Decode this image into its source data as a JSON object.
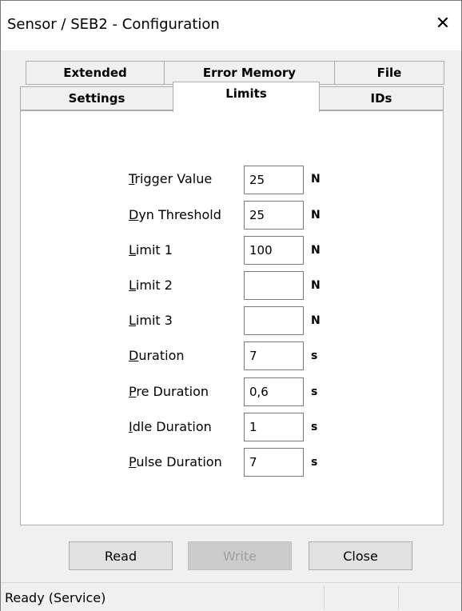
{
  "window": {
    "title": "Sensor / SEB2 - Configuration",
    "close_glyph": "✕"
  },
  "tabs": {
    "row_back": [
      {
        "label": "Extended"
      },
      {
        "label": "Error Memory"
      },
      {
        "label": "File"
      }
    ],
    "row_front": [
      {
        "label": "Settings"
      },
      {
        "label": "Limits",
        "active": true
      },
      {
        "label": "IDs"
      }
    ]
  },
  "fields": [
    {
      "mnemonic": "T",
      "rest": "rigger Value",
      "value": "25",
      "unit": "N"
    },
    {
      "mnemonic": "D",
      "rest": "yn Threshold",
      "value": "25",
      "unit": "N"
    },
    {
      "mnemonic": "L",
      "rest": "imit 1",
      "value": "100",
      "unit": "N"
    },
    {
      "mnemonic": "L",
      "rest": "imit 2",
      "value": "",
      "unit": "N"
    },
    {
      "mnemonic": "L",
      "rest": "imit 3",
      "value": "",
      "unit": "N"
    },
    {
      "mnemonic": "D",
      "rest": "uration",
      "value": "7",
      "unit": "s"
    },
    {
      "mnemonic": "P",
      "rest": "re Duration",
      "value": "0,6",
      "unit": "s"
    },
    {
      "mnemonic": "I",
      "rest": "dle Duration",
      "value": "1",
      "unit": "s"
    },
    {
      "mnemonic": "P",
      "rest": "ulse Duration",
      "value": "7",
      "unit": "s"
    }
  ],
  "buttons": {
    "read": "Read",
    "write": "Write",
    "close": "Close"
  },
  "status": {
    "text": "Ready (Service)"
  }
}
